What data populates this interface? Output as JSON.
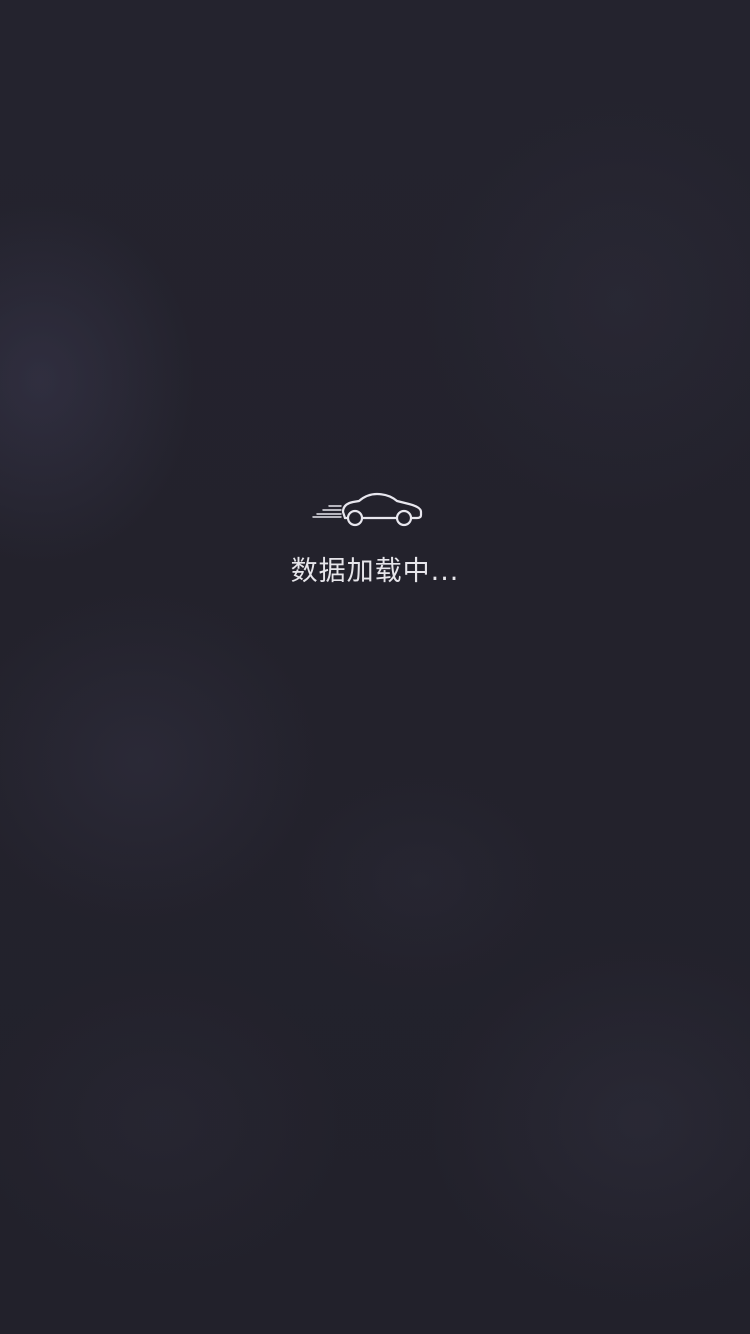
{
  "loading": {
    "icon": "car-icon",
    "text": "数据加载中..."
  },
  "colors": {
    "background": "#23222d",
    "text": "#e6e5ea",
    "icon": "#e8e7ee"
  }
}
